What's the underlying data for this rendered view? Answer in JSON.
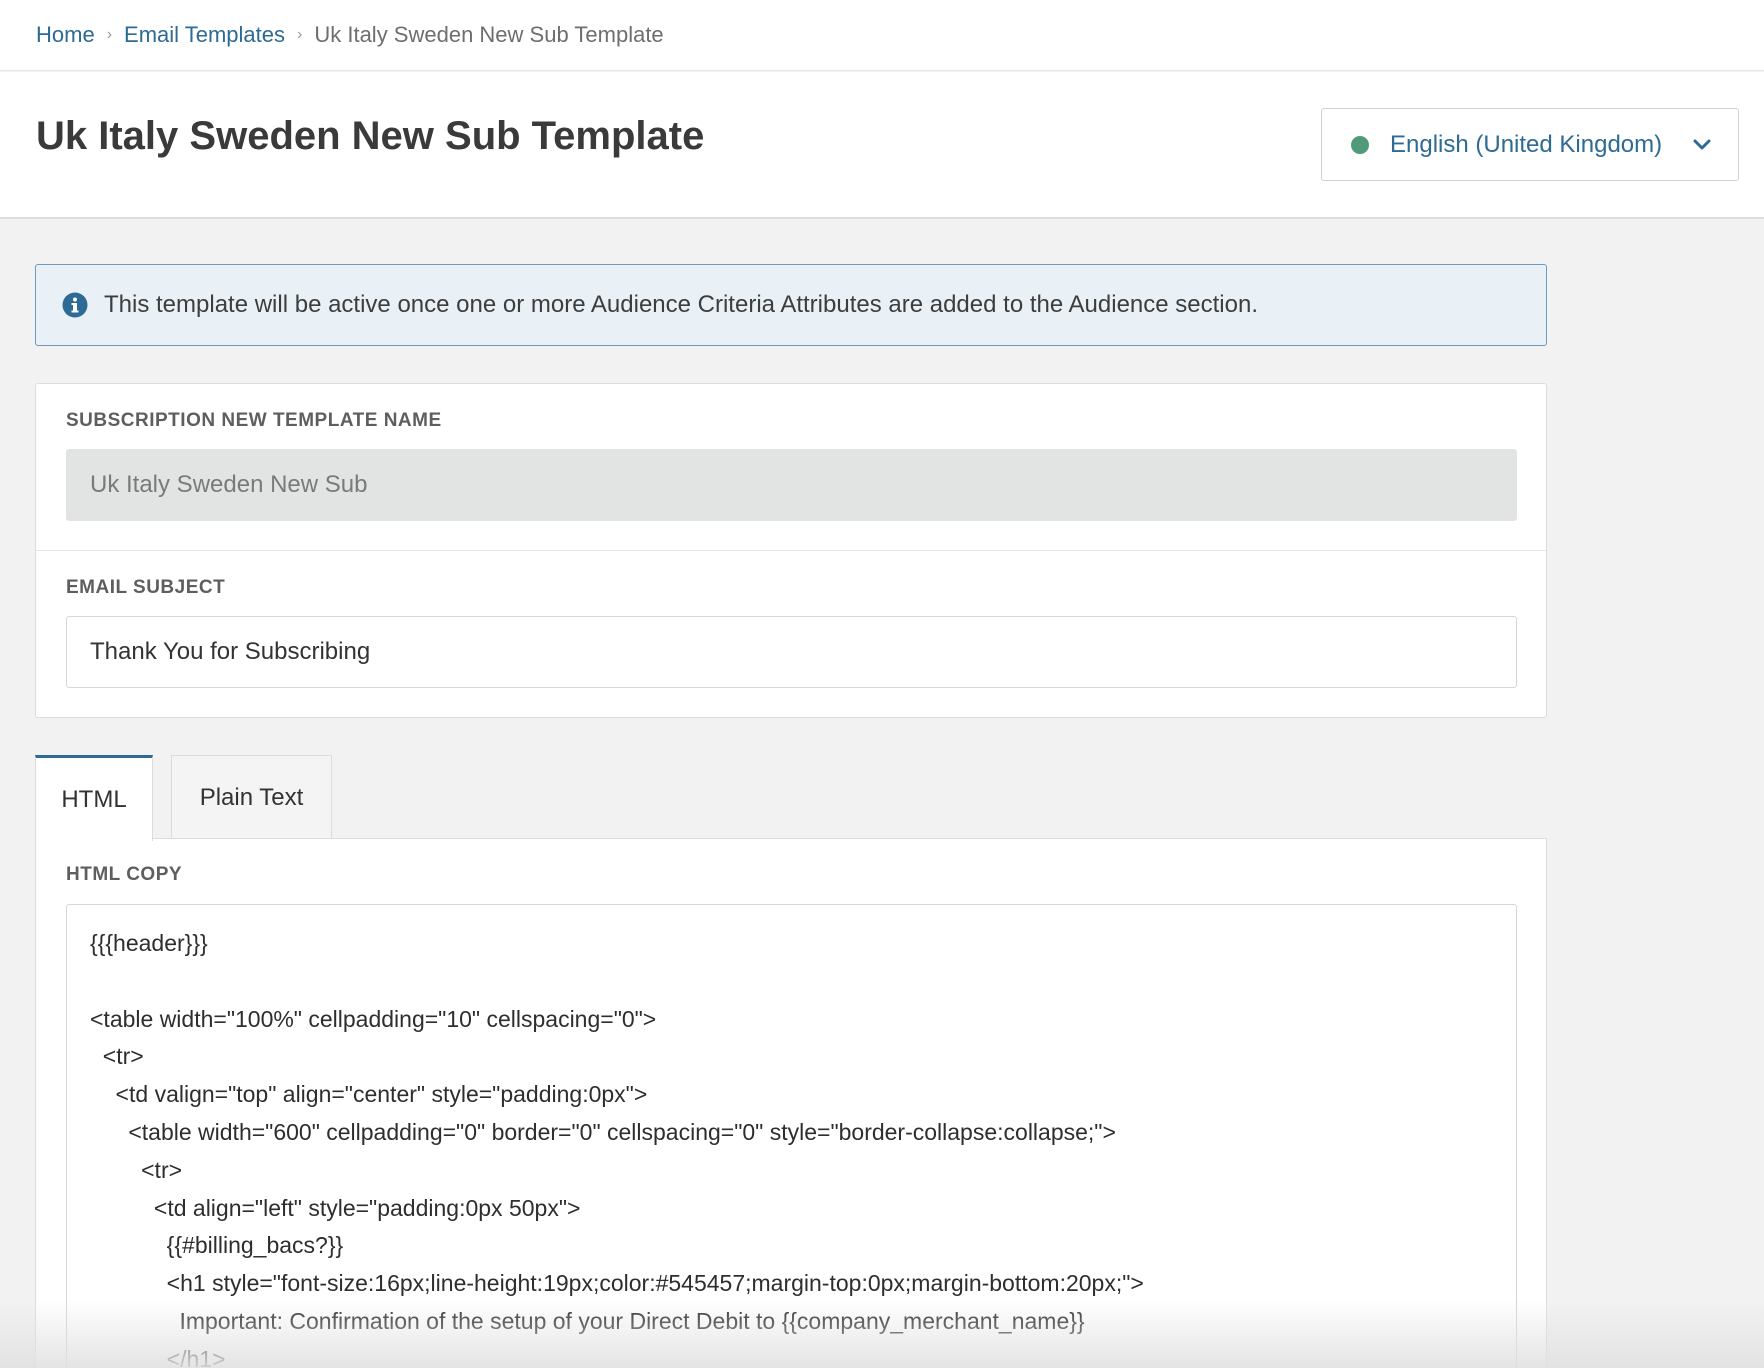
{
  "breadcrumb": {
    "home": "Home",
    "email_templates": "Email Templates",
    "current": "Uk Italy Sweden New Sub Template",
    "separator": "›"
  },
  "header": {
    "title": "Uk Italy Sweden New Sub Template",
    "locale": {
      "label": "English (United Kingdom)",
      "status_color": "#4f9a7a"
    }
  },
  "info_banner": {
    "text": "This template will be active once one or more Audience Criteria Attributes are added to the Audience section."
  },
  "form": {
    "template_name": {
      "label": "SUBSCRIPTION NEW TEMPLATE NAME",
      "value": "Uk Italy Sweden New Sub"
    },
    "email_subject": {
      "label": "EMAIL SUBJECT",
      "value": "Thank You for Subscribing"
    }
  },
  "tabs": [
    {
      "label": "HTML",
      "active": true
    },
    {
      "label": "Plain Text",
      "active": false
    }
  ],
  "editor": {
    "label": "HTML COPY",
    "lines": [
      "{{{header}}}",
      "",
      "<table width=\"100%\" cellpadding=\"10\" cellspacing=\"0\">",
      "  <tr>",
      "    <td valign=\"top\" align=\"center\" style=\"padding:0px\">",
      "      <table width=\"600\" cellpadding=\"0\" border=\"0\" cellspacing=\"0\" style=\"border-collapse:collapse;\">",
      "        <tr>",
      "          <td align=\"left\" style=\"padding:0px 50px\">",
      "            {{#billing_bacs?}}",
      "            <h1 style=\"font-size:16px;line-height:19px;color:#545457;margin-top:0px;margin-bottom:20px;\">",
      "              Important: Confirmation of the setup of your Direct Debit to {{company_merchant_name}}",
      "            </h1>"
    ]
  },
  "colors": {
    "accent": "#2d6a94",
    "banner_bg": "#eaf1f6",
    "banner_border": "#6b9bc0"
  }
}
